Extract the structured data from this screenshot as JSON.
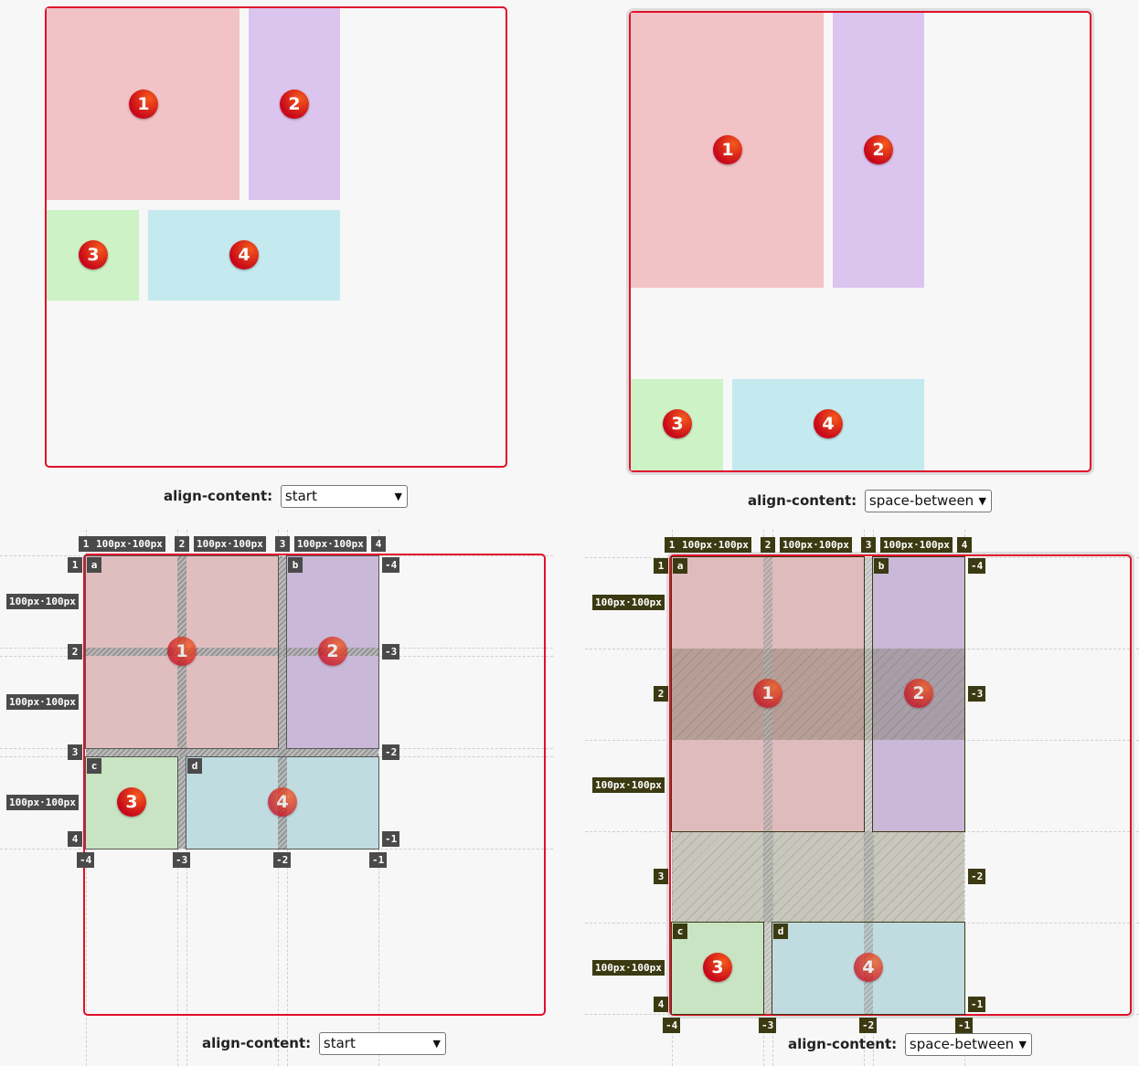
{
  "items": [
    "1",
    "2",
    "3",
    "4"
  ],
  "areas": [
    "a",
    "b",
    "c",
    "d"
  ],
  "controls": {
    "label": "align-content:",
    "left_value": "start",
    "right_value": "space-between"
  },
  "grid_labels": {
    "track_size": "100px·100px",
    "lines_positive": [
      "1",
      "2",
      "3",
      "4"
    ],
    "lines_negative": [
      "-4",
      "-3",
      "-2",
      "-1"
    ]
  },
  "colors": {
    "container_border": "#e0102a",
    "item_1": "#f2c3c6",
    "item_2": "#dbc4ee",
    "item_3": "#cdf2c6",
    "item_4": "#c4e9ef",
    "badge_gradient": "#c8081a",
    "grid_label_grey": "#4a4a4a",
    "grid_label_olive": "#3b3a12"
  }
}
